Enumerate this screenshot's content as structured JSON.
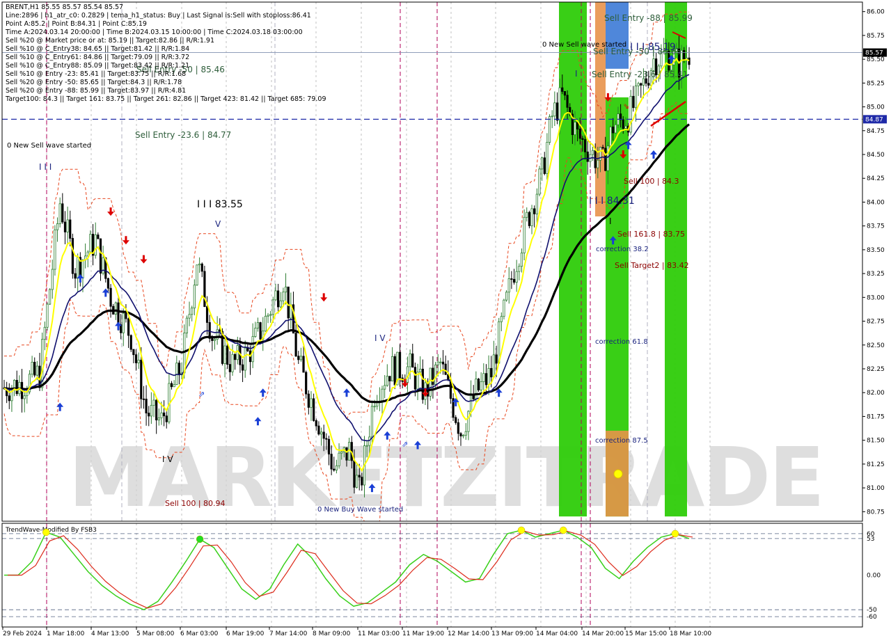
{
  "header": {
    "symbol_line": "BRENT,H1  85.55 85.57 85.54 85.57",
    "info_lines": [
      "Line:2896  |  h1_atr_c0: 0.2829  |  tema_h1_status: Buy  |  Last Signal is:Sell with stoploss:86.41",
      "Point A:85.2  |  Point B:84.31  |  Point C:85.19",
      "Time A:2024.03.14 20:00:00  |  Time B:2024.03.15 10:00:00  |  Time C:2024.03.18 03:00:00",
      "Sell %20 @ Market price or at: 85.19  ||  Target:82.86  ||  R/R:1.91",
      "Sell %10 @ C_Entry38: 84.65  ||  Target:81.42  ||  R/R:1.84",
      "Sell %10 @ C_Entry61: 84.86  ||  Target:79.09  ||  R/R:3.72",
      "Sell %10 @ C_Entry88: 85.09  ||  Target:83.42  ||  R/R:1.21",
      "Sell %10 @ Entry -23: 85.41  ||  Target:83.75  ||  R/R:1.68",
      "Sell %20 @ Entry -50: 85.65  ||  Target:84.3  ||  R/R:1.78",
      "Sell %20 @ Entry -88: 85.99  ||  Target:83.97  ||  R/R:4.81",
      "Target100: 84.3  ||  Target 161: 83.75  ||  Target 261: 82.86  ||  Target 423: 81.42  ||  Target 685: 79.09"
    ]
  },
  "colors": {
    "background": "#ffffff",
    "grid": "#c0c0c0",
    "bull_candle": "#2e7d32",
    "bear_candle": "#000000",
    "yellow_ma": "#ffff00",
    "navy_ma": "#10106e",
    "black_ma": "#000000",
    "channel": "#e8461e",
    "green_zone": "#2ecc0a",
    "orange_zone": "#e8924a",
    "blue_zone": "#3c7ad6",
    "dashed_level": "#1f2aa8",
    "magenta_session": "#b0005a",
    "arrow_up": "#1a3fd6",
    "arrow_down": "#dd0000",
    "osc_red": "#dd2a1a",
    "osc_green": "#39d01a",
    "watermark": "#d9d9d9"
  },
  "watermark_text": "MARKETZITRADE",
  "annotations": [
    {
      "text": "Sell Entry -88 | 85.99",
      "color": "green"
    },
    {
      "text": "0 New Sell wave started",
      "color": "black"
    },
    {
      "text": "Sell Entry -50 | 85.65",
      "color": "green"
    },
    {
      "text": "I I I 85.19",
      "color": "blue"
    },
    {
      "text": "Sell Entry -23.6 | 85.41",
      "color": "green"
    },
    {
      "text": "Sell Entry -50 | 85.46",
      "color": "green"
    },
    {
      "text": "0 New Sell wave started",
      "color": "black"
    },
    {
      "text": "Sell Entry -23.6 | 84.77",
      "color": "green"
    },
    {
      "text": "I I I",
      "color": "blue"
    },
    {
      "text": "I I I 83.55",
      "color": "black"
    },
    {
      "text": "V",
      "color": "blue"
    },
    {
      "text": "I V",
      "color": "black"
    },
    {
      "text": "I V",
      "color": "blue"
    },
    {
      "text": "Sell 100 | 80.94",
      "color": "darkred"
    },
    {
      "text": "0 New Buy Wave started",
      "color": "blue"
    },
    {
      "text": "Sell 100 | 84.3",
      "color": "darkred"
    },
    {
      "text": "I I I 84.31",
      "color": "blue"
    },
    {
      "text": "Sell 161.8 | 83.75",
      "color": "darkred"
    },
    {
      "text": "correction 38.2",
      "color": "blue"
    },
    {
      "text": "Sell Target2 | 83.42",
      "color": "darkred"
    },
    {
      "text": "correction 61.8",
      "color": "blue"
    },
    {
      "text": "correction 87.5",
      "color": "blue"
    },
    {
      "text": "I",
      "color": "blue"
    },
    {
      "text": "I",
      "color": "black"
    }
  ],
  "price_labels": {
    "current": "85.57",
    "level": "84.87"
  },
  "oscillator": {
    "title": "TrendWave-Modified By FSB3",
    "levels": [
      "60",
      "53",
      "0.00",
      "-50",
      "-60"
    ]
  },
  "chart_data": [
    {
      "type": "candlestick",
      "title": "BRENT,H1",
      "y_ticks": [
        "86.00",
        "85.75",
        "85.50",
        "85.25",
        "85.00",
        "84.75",
        "84.50",
        "84.25",
        "84.00",
        "83.75",
        "83.50",
        "83.25",
        "83.00",
        "82.75",
        "82.50",
        "82.25",
        "82.00",
        "81.75",
        "81.50",
        "81.25",
        "81.00",
        "80.75"
      ],
      "x_ticks": [
        "29 Feb 2024",
        "1 Mar 18:00",
        "4 Mar 13:00",
        "5 Mar 08:00",
        "6 Mar 03:00",
        "6 Mar 19:00",
        "7 Mar 14:00",
        "8 Mar 09:00",
        "11 Mar 03:00",
        "11 Mar 19:00",
        "12 Mar 14:00",
        "13 Mar 09:00",
        "14 Mar 04:00",
        "14 Mar 20:00",
        "15 Mar 15:00",
        "18 Mar 10:00"
      ],
      "ylim": [
        80.65,
        86.1
      ],
      "close_path": [
        [
          0,
          82.05
        ],
        [
          8,
          82.1
        ],
        [
          14,
          82.2
        ],
        [
          22,
          84.0
        ],
        [
          28,
          83.3
        ],
        [
          36,
          83.6
        ],
        [
          42,
          83.0
        ],
        [
          50,
          82.6
        ],
        [
          56,
          81.8
        ],
        [
          62,
          81.7
        ],
        [
          70,
          82.3
        ],
        [
          76,
          83.4
        ],
        [
          82,
          82.6
        ],
        [
          90,
          82.3
        ],
        [
          96,
          82.4
        ],
        [
          102,
          82.7
        ],
        [
          110,
          83.2
        ],
        [
          116,
          82.3
        ],
        [
          124,
          81.7
        ],
        [
          130,
          81.2
        ],
        [
          136,
          81.4
        ],
        [
          140,
          80.95
        ],
        [
          146,
          82.0
        ],
        [
          152,
          82.25
        ],
        [
          160,
          82.25
        ],
        [
          166,
          82.0
        ],
        [
          172,
          82.3
        ],
        [
          180,
          81.6
        ],
        [
          186,
          82.0
        ],
        [
          192,
          82.2
        ],
        [
          200,
          83.2
        ],
        [
          206,
          83.8
        ],
        [
          212,
          84.3
        ],
        [
          216,
          84.9
        ],
        [
          220,
          85.1
        ],
        [
          226,
          84.7
        ],
        [
          232,
          84.5
        ],
        [
          236,
          84.4
        ],
        [
          240,
          84.8
        ],
        [
          246,
          84.9
        ],
        [
          250,
          85.1
        ],
        [
          256,
          85.5
        ],
        [
          262,
          85.55
        ],
        [
          266,
          85.45
        ],
        [
          270,
          85.57
        ]
      ],
      "levels": {
        "dashed_84_87": 84.87
      },
      "zones": [
        {
          "kind": "green",
          "x": [
            803,
            843
          ],
          "y": [
            80.7,
            86.1
          ]
        },
        {
          "kind": "green",
          "x": [
            870,
            903
          ],
          "y": [
            80.7,
            85.1
          ]
        },
        {
          "kind": "orange",
          "x": [
            870,
            903
          ],
          "y": [
            80.7,
            81.6
          ]
        },
        {
          "kind": "orange",
          "x": [
            855,
            870
          ],
          "y": [
            83.85,
            86.1
          ]
        },
        {
          "kind": "blue",
          "x": [
            870,
            903
          ],
          "y": [
            85.4,
            86.1
          ]
        },
        {
          "kind": "green",
          "x": [
            955,
            987
          ],
          "y": [
            80.7,
            86.1
          ]
        }
      ]
    },
    {
      "type": "line",
      "title": "TrendWave-Modified By FSB3",
      "ylim": [
        -75,
        75
      ],
      "y_ticks": [
        "60",
        "53",
        "0.00",
        "-50",
        "-60"
      ],
      "series": [
        {
          "values": [
            0,
            0,
            20,
            62,
            55,
            30,
            5,
            -15,
            -30,
            -42,
            -50,
            -38,
            -10,
            20,
            52,
            40,
            10,
            -20,
            -35,
            -20,
            15,
            45,
            25,
            -5,
            -30,
            -45,
            -40,
            -25,
            -10,
            15,
            30,
            20,
            5,
            -10,
            -5,
            30,
            60,
            65,
            55,
            60,
            65,
            55,
            40,
            10,
            -5,
            20,
            40,
            55,
            60,
            53
          ]
        }
      ]
    }
  ]
}
